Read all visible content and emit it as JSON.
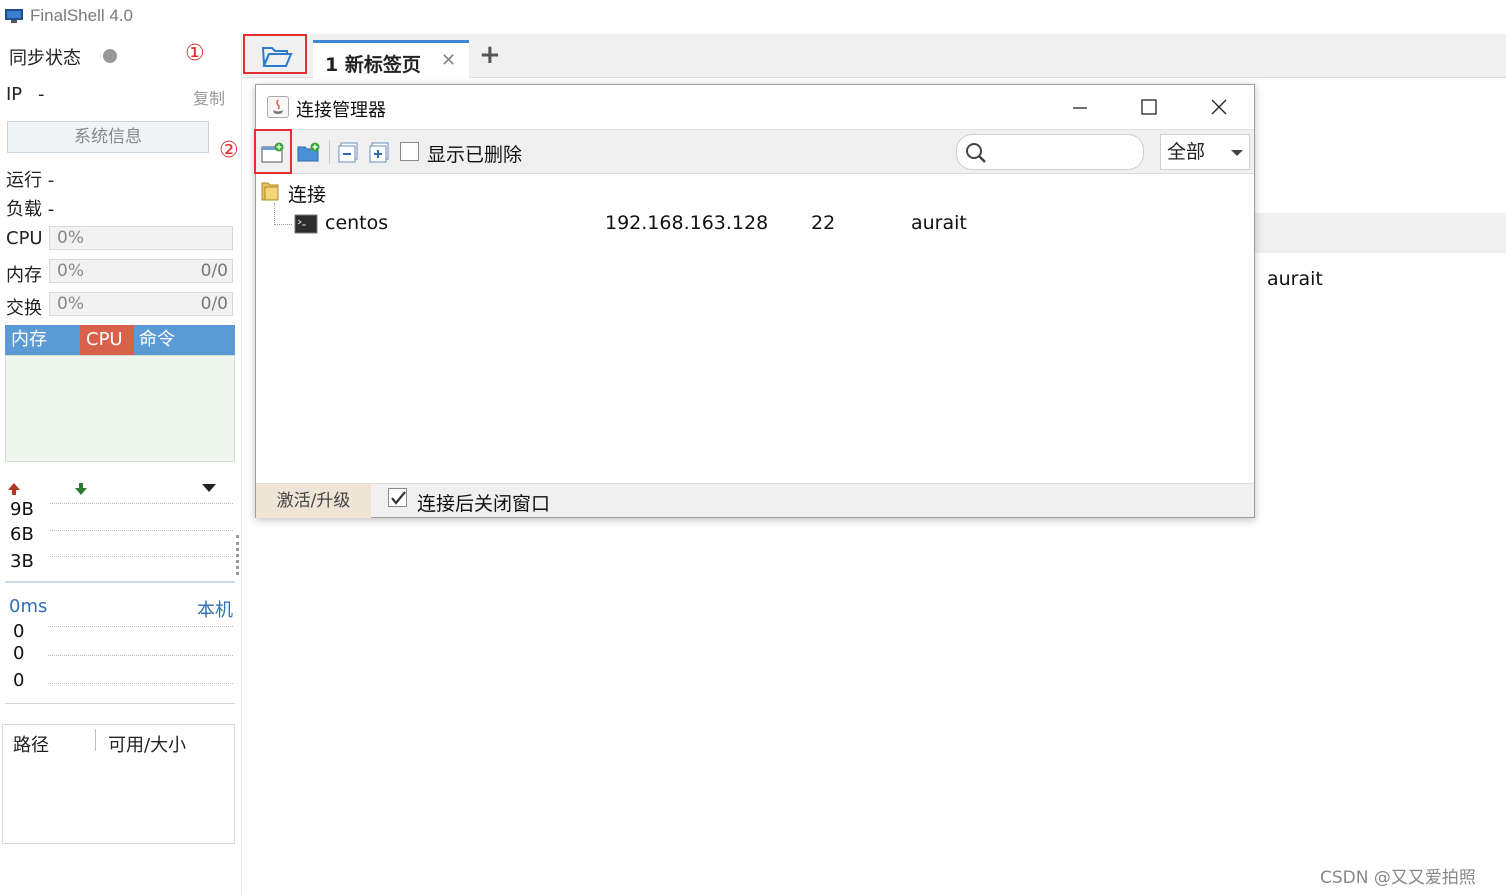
{
  "app": {
    "title": "FinalShell 4.0"
  },
  "sidebar": {
    "sync_label": "同步状态",
    "annotation_1": "①",
    "annotation_2": "②",
    "ip_label": "IP",
    "ip_value": "-",
    "copy_label": "复制",
    "sysinfo_button": "系统信息",
    "uptime_label": "运行 -",
    "load_label": "负载 -",
    "cpu": {
      "label": "CPU",
      "value": "0%"
    },
    "memory": {
      "label": "内存",
      "value": "0%",
      "detail": "0/0"
    },
    "swap": {
      "label": "交换",
      "value": "0%",
      "detail": "0/0"
    },
    "process_tabs": [
      "内存",
      "CPU",
      "命令"
    ],
    "net_ticks": [
      "9B",
      "6B",
      "3B"
    ],
    "ping_value": "0ms",
    "ping_host": "本机",
    "ping_ticks": [
      "0",
      "0",
      "0"
    ],
    "disk_headers": [
      "路径",
      "可用/大小"
    ]
  },
  "tabs": [
    {
      "label": "1 新标签页"
    }
  ],
  "main_bg": {
    "user": "aurait"
  },
  "dialog": {
    "title": "连接管理器",
    "show_deleted_label": "显示已删除",
    "search_placeholder": "",
    "filter_value": "全部",
    "tree": {
      "folder": "连接",
      "connections": [
        {
          "name": "centos",
          "host": "192.168.163.128",
          "port": "22",
          "user": "aurait"
        }
      ]
    },
    "activate_label": "激活/升级",
    "close_after_label": "连接后关闭窗口",
    "close_after_checked": true
  },
  "watermark": "CSDN @又又爱拍照",
  "colors": {
    "accent_blue": "#5b9bd5",
    "cpu_tab_red": "#d9604a",
    "annotation_red": "#e03030",
    "ping_blue": "#2f6fb5"
  }
}
